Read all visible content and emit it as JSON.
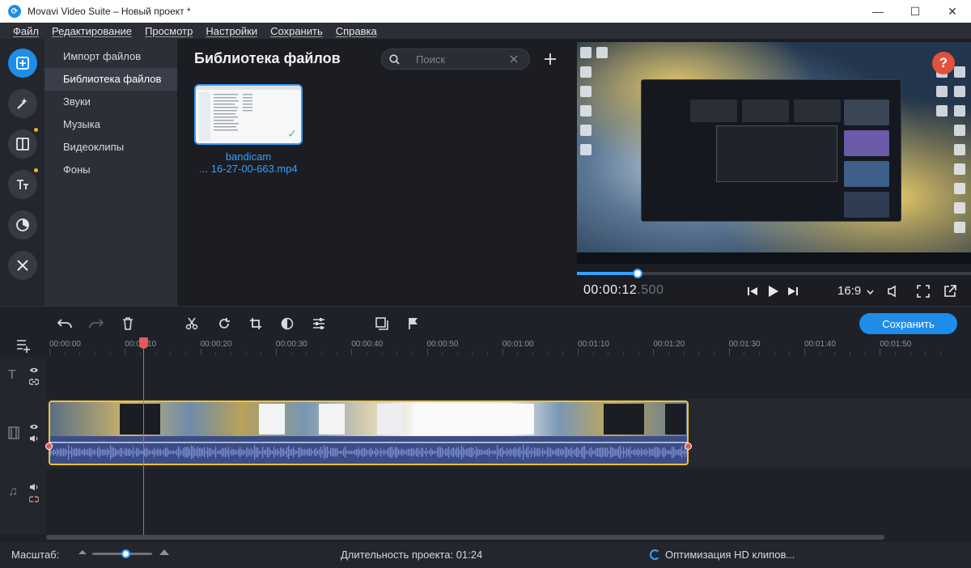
{
  "window": {
    "title": "Movavi Video Suite – Новый проект *",
    "minimize": "—",
    "maximize": "☐",
    "close": "✕"
  },
  "menu": [
    "Файл",
    "Редактирование",
    "Просмотр",
    "Настройки",
    "Сохранить",
    "Справка"
  ],
  "rail": [
    "import-icon",
    "magic-wand-icon",
    "transitions-icon",
    "titles-icon",
    "filters-icon",
    "tools-icon"
  ],
  "categories": [
    {
      "label": "Импорт файлов",
      "active": false
    },
    {
      "label": "Библиотека файлов",
      "active": true
    },
    {
      "label": "Звуки",
      "active": false
    },
    {
      "label": "Музыка",
      "active": false
    },
    {
      "label": "Видеоклипы",
      "active": false
    },
    {
      "label": "Фоны",
      "active": false
    }
  ],
  "library": {
    "title": "Библиотека файлов",
    "search_placeholder": "Поиск",
    "file": {
      "name_line1": "bandicam",
      "name_line2": "... 16-27-00-663.mp4"
    }
  },
  "player": {
    "timecode_main": "00:00:12",
    "timecode_ms": ".500",
    "aspect": "16:9",
    "progress": 0.155,
    "help": "?"
  },
  "timeline": {
    "save_label": "Сохранить",
    "ticks": [
      "00:00:00",
      "00:00:10",
      "00:00:20",
      "00:00:30",
      "00:00:40",
      "00:00:50",
      "00:01:00",
      "00:01:10",
      "00:01:20",
      "00:01:30",
      "00:01:40",
      "00:01:50"
    ]
  },
  "status": {
    "zoom_label": "Масштаб:",
    "zoom_level": 0.55,
    "duration": "Длительность проекта:  01:24",
    "optimize": "Оптимизация HD клипов..."
  },
  "colors": {
    "accent": "#1d8de9",
    "clip_border": "#f1c232",
    "playhead": "#e25a5a",
    "help": "#e2513a"
  }
}
